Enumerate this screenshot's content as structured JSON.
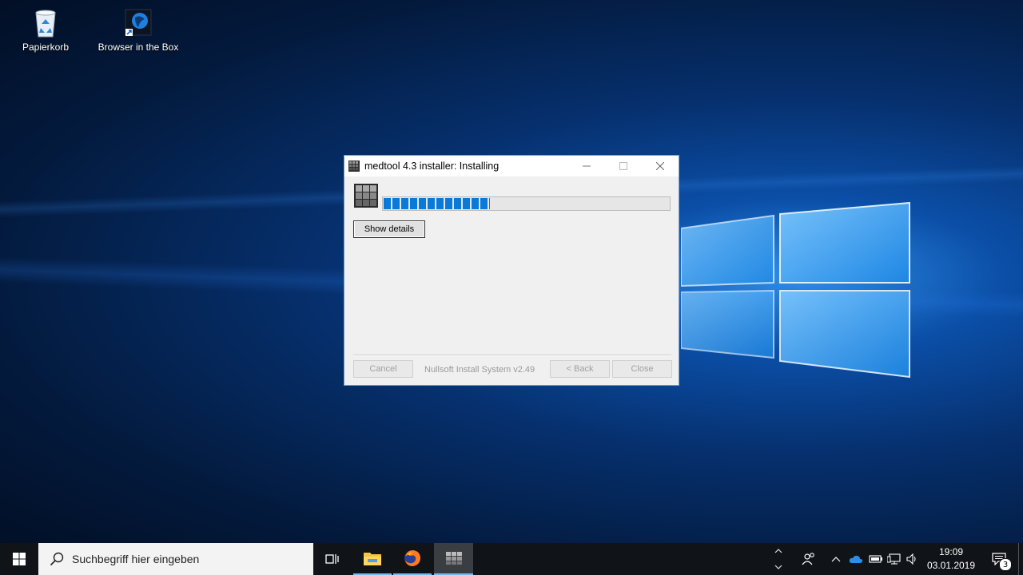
{
  "desktop": {
    "icons": [
      {
        "label": "Papierkorb",
        "icon": "recycle-bin-icon"
      },
      {
        "label": "Browser in the Box",
        "icon": "browser-in-the-box-icon"
      }
    ]
  },
  "installer": {
    "title": "medtool 4.3 installer: Installing",
    "progress_fraction": 0.37,
    "show_details_label": "Show details",
    "cancel_label": "Cancel",
    "branding": "Nullsoft Install System v2.49",
    "back_label": "< Back",
    "close_label": "Close"
  },
  "taskbar": {
    "search_placeholder": "Suchbegriff hier eingeben",
    "clock_time": "19:09",
    "clock_date": "03.01.2019",
    "notification_count": "3"
  },
  "colors": {
    "accent": "#0a7ad8",
    "taskbar": "#101318",
    "active_indicator": "#76b9ed"
  }
}
